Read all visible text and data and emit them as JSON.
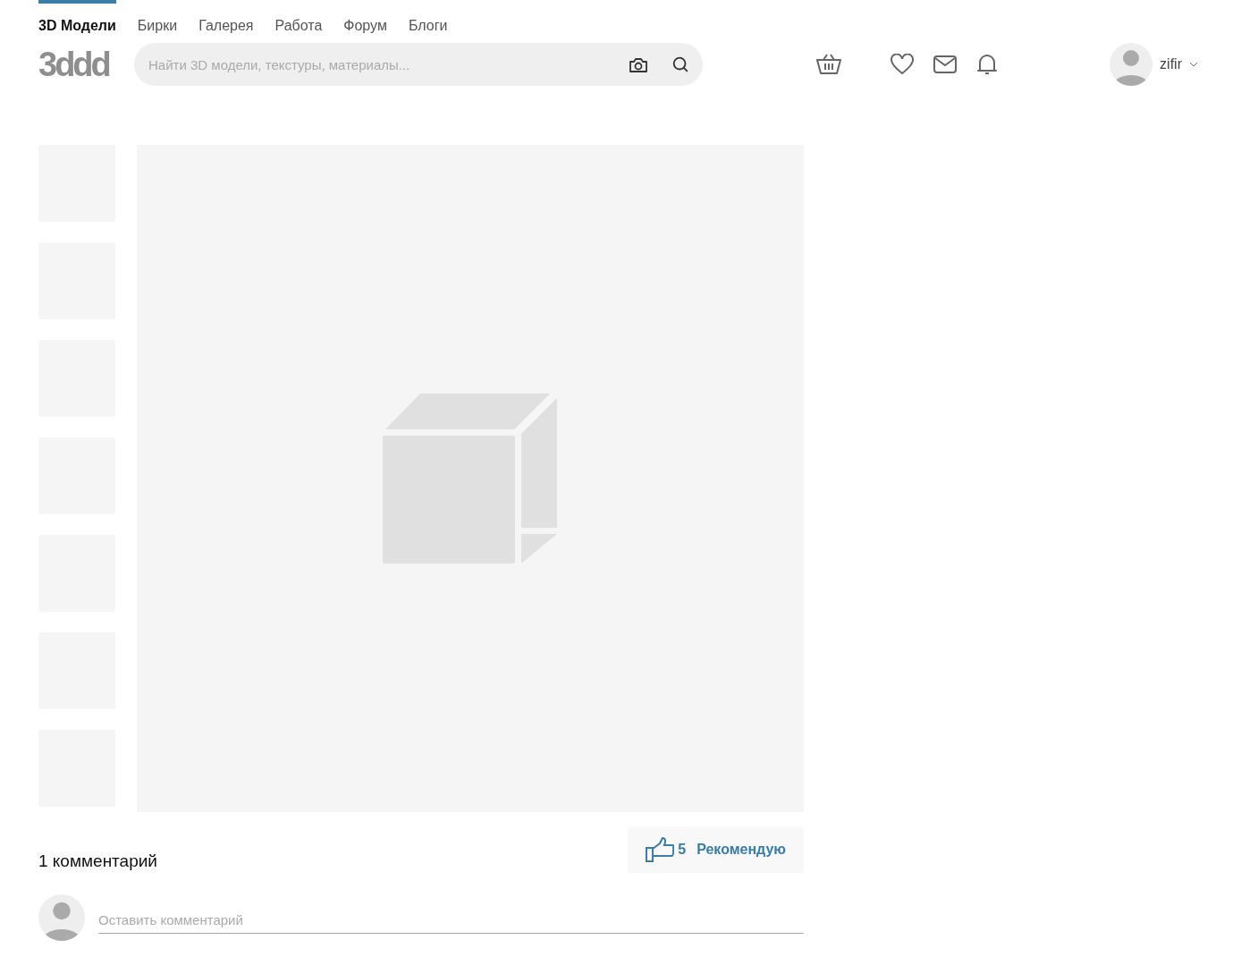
{
  "nav_tabs": [
    {
      "label": "3D Модели",
      "selected": true
    },
    {
      "label": "Бирки",
      "selected": false
    },
    {
      "label": "Галерея",
      "selected": false
    },
    {
      "label": "Работа",
      "selected": false
    },
    {
      "label": "Форум",
      "selected": false
    },
    {
      "label": "Блоги",
      "selected": false
    }
  ],
  "logo": "3ddd",
  "search": {
    "placeholder": "Найти 3D модели, текстуры, материалы..."
  },
  "user": {
    "name": "zifir"
  },
  "thumbnails": [
    {
      "kind": "placeholder"
    },
    {
      "kind": "placeholder"
    },
    {
      "kind": "placeholder"
    },
    {
      "kind": "placeholder"
    },
    {
      "kind": "placeholder"
    },
    {
      "kind": "placeholder"
    },
    {
      "kind": "placeholder"
    }
  ],
  "preview": {
    "kind": "placeholder"
  },
  "recommend": {
    "count": "5",
    "label": "Рекомендую"
  },
  "comments": {
    "title": "1 комментарий",
    "placeholder": "Оставить комментарий"
  }
}
